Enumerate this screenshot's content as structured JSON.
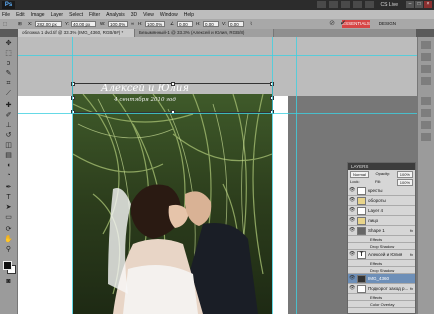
{
  "app": {
    "logo": "Ps"
  },
  "cs_live": "CS Live",
  "menu": [
    "File",
    "Edit",
    "Image",
    "Layer",
    "Select",
    "Filter",
    "Analysis",
    "3D",
    "View",
    "Window",
    "Help"
  ],
  "options": {
    "x": "282.00 px",
    "y": "40.00 px",
    "w": "100.0%",
    "h": "100.0%",
    "angle": "0.00",
    "skew_h": "0.00",
    "skew_v": "0.00",
    "essentials": "ESSENTIALS",
    "design": "DESIGN"
  },
  "tabs": [
    "обложка 1 dvd.tif @ 33.3% (IMG_4360, RGB/8#) *",
    "Безымянный-1 @ 33.3% (Алексей и Юлия, RGB/8)"
  ],
  "canvas": {
    "title": "Алексей и Юлия",
    "date": "4 сентября 2010 год"
  },
  "layers_panel": {
    "title": "LAYERS",
    "blend": "Normal",
    "opacity_label": "Opacity:",
    "opacity": "100%",
    "lock_label": "Lock:",
    "fill_label": "Fill:",
    "fill": "100%",
    "rows": [
      {
        "name": "кресты",
        "type": "layer"
      },
      {
        "name": "обороты",
        "type": "group"
      },
      {
        "name": "Layer 4",
        "type": "layer"
      },
      {
        "name": "лицо",
        "type": "group"
      },
      {
        "name": "Shape 1",
        "type": "shape",
        "fx": "fx"
      },
      {
        "name": "Effects",
        "type": "sub"
      },
      {
        "name": "Drop Shadow",
        "type": "sub"
      },
      {
        "name": "Алексей и Юлия",
        "type": "text",
        "fx": "fx"
      },
      {
        "name": "Effects",
        "type": "sub"
      },
      {
        "name": "Drop Shadow",
        "type": "sub"
      },
      {
        "name": "IMG_4360",
        "type": "photo",
        "selected": true
      },
      {
        "name": "Подкорот заход р...",
        "type": "layer",
        "fx": "fx"
      },
      {
        "name": "Effects",
        "type": "sub"
      },
      {
        "name": "Color Overlay",
        "type": "sub"
      }
    ]
  },
  "colors": {
    "accent_essentials": "#d64545",
    "selection": "#6d8fb8",
    "guide": "#3fd0e0"
  }
}
